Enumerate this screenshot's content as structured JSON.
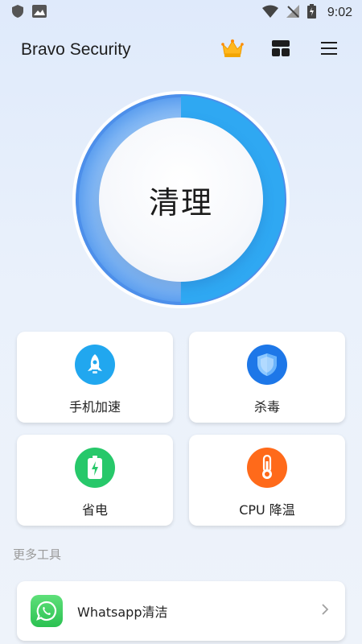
{
  "status_bar": {
    "time": "9:02",
    "left_icons": [
      "shield-icon",
      "image-icon"
    ],
    "right_icons": [
      "wifi-icon",
      "no-signal-icon",
      "battery-charging-icon"
    ]
  },
  "header": {
    "title": "Bravo Security",
    "actions": [
      "crown-icon",
      "dashboard-icon",
      "menu-icon"
    ]
  },
  "main": {
    "clean_label": "清理",
    "progress_percent": 0.5,
    "ring_colors": {
      "track": "#9cc6f7",
      "outer": "#5a9ff0",
      "fill": "#2fa8f2"
    }
  },
  "features": [
    {
      "label": "手机加速",
      "icon": "rocket-icon",
      "color": "#21a7ef"
    },
    {
      "label": "杀毒",
      "icon": "shield-icon",
      "color": "#1d77e8"
    },
    {
      "label": "省电",
      "icon": "battery-icon",
      "color": "#27c86a"
    },
    {
      "label": "CPU 降温",
      "icon": "thermometer-icon",
      "color": "#ff6a1a"
    }
  ],
  "more_tools": {
    "heading": "更多工具",
    "items": [
      {
        "label": "Whatsapp清洁",
        "icon": "whatsapp-icon"
      }
    ]
  }
}
